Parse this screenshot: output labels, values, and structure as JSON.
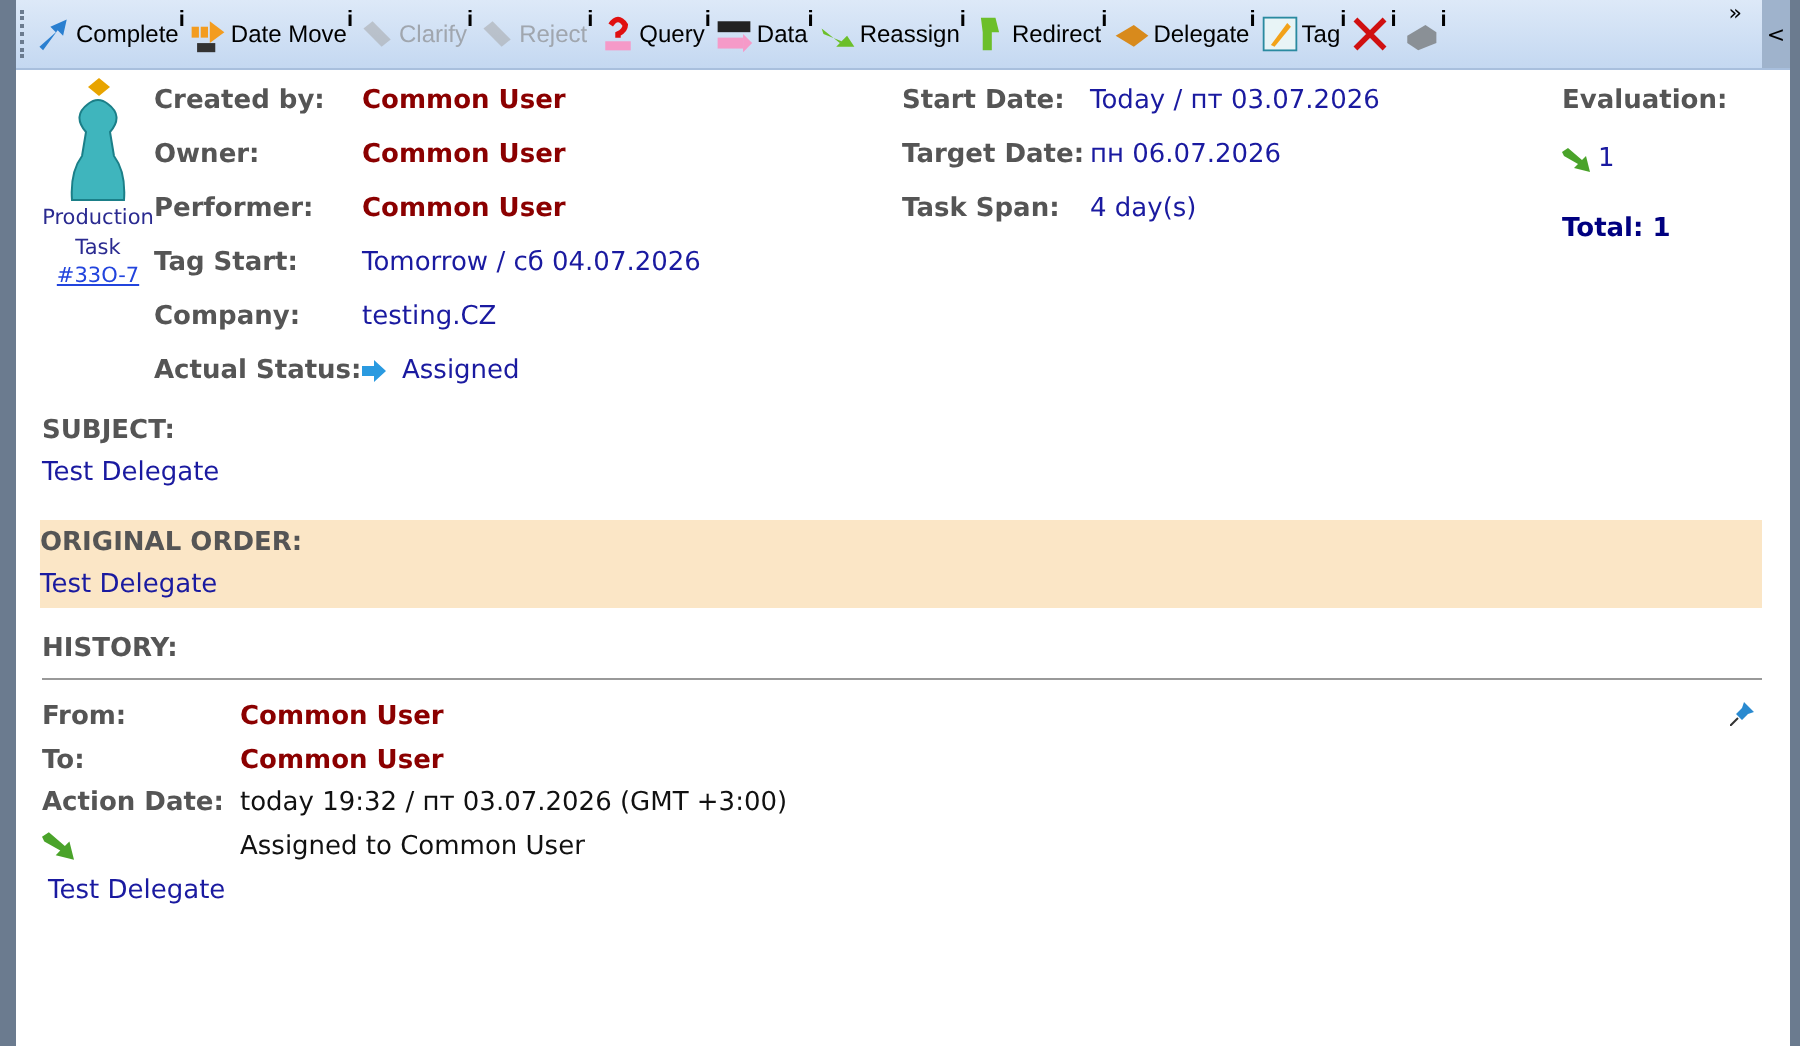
{
  "toolbar": {
    "buttons": [
      {
        "label": "Complete",
        "info": "i",
        "disabled": false
      },
      {
        "label": "Date Move",
        "info": "i",
        "disabled": false
      },
      {
        "label": "Clarify",
        "info": "i",
        "disabled": true
      },
      {
        "label": "Reject",
        "info": "i",
        "disabled": true
      },
      {
        "label": "Query",
        "info": "i",
        "disabled": false
      },
      {
        "label": "Data",
        "info": "i",
        "disabled": false
      },
      {
        "label": "Reassign",
        "info": "i",
        "disabled": false
      },
      {
        "label": "Redirect",
        "info": "i",
        "disabled": false
      },
      {
        "label": "Delegate",
        "info": "i",
        "disabled": false
      },
      {
        "label": "Tag",
        "info": "i",
        "disabled": false
      },
      {
        "info": "i",
        "disabled": false
      },
      {
        "info": "i",
        "disabled": false
      }
    ],
    "overflow": "»",
    "collapse": "<"
  },
  "task": {
    "type": "Production Task",
    "number": "#33O-7"
  },
  "fields_left": [
    {
      "label": "Created by:",
      "value": "Common User",
      "kind": "person"
    },
    {
      "label": "Owner:",
      "value": "Common User",
      "kind": "person"
    },
    {
      "label": "Performer:",
      "value": "Common User",
      "kind": "person"
    },
    {
      "label": "Tag Start:",
      "value": "Tomorrow / сб 04.07.2026",
      "kind": "plain"
    },
    {
      "label": "Company:",
      "value": "testing.CZ",
      "kind": "plain"
    },
    {
      "label": "Actual Status:",
      "value": "Assigned",
      "kind": "status"
    }
  ],
  "fields_right": [
    {
      "label": "Start Date:",
      "value": "Today / пт 03.07.2026"
    },
    {
      "label": "Target Date:",
      "value": "пн 06.07.2026"
    },
    {
      "label": "Task Span:",
      "value": "4 day(s)"
    }
  ],
  "evaluation": {
    "label": "Evaluation:",
    "count": "1",
    "total": "Total: 1"
  },
  "subject": {
    "heading": "SUBJECT:",
    "text": "Test Delegate"
  },
  "original_order": {
    "heading": "ORIGINAL ORDER:",
    "text": "Test Delegate"
  },
  "history": {
    "heading": "HISTORY:",
    "entries": [
      {
        "from_label": "From:",
        "from": "Common User",
        "to_label": "To:",
        "to": "Common User",
        "date_label": "Action Date:",
        "date": "today 19:32 / пт 03.07.2026 (GMT +3:00)",
        "action": "Assigned to Common User",
        "note": "Test Delegate"
      }
    ]
  }
}
